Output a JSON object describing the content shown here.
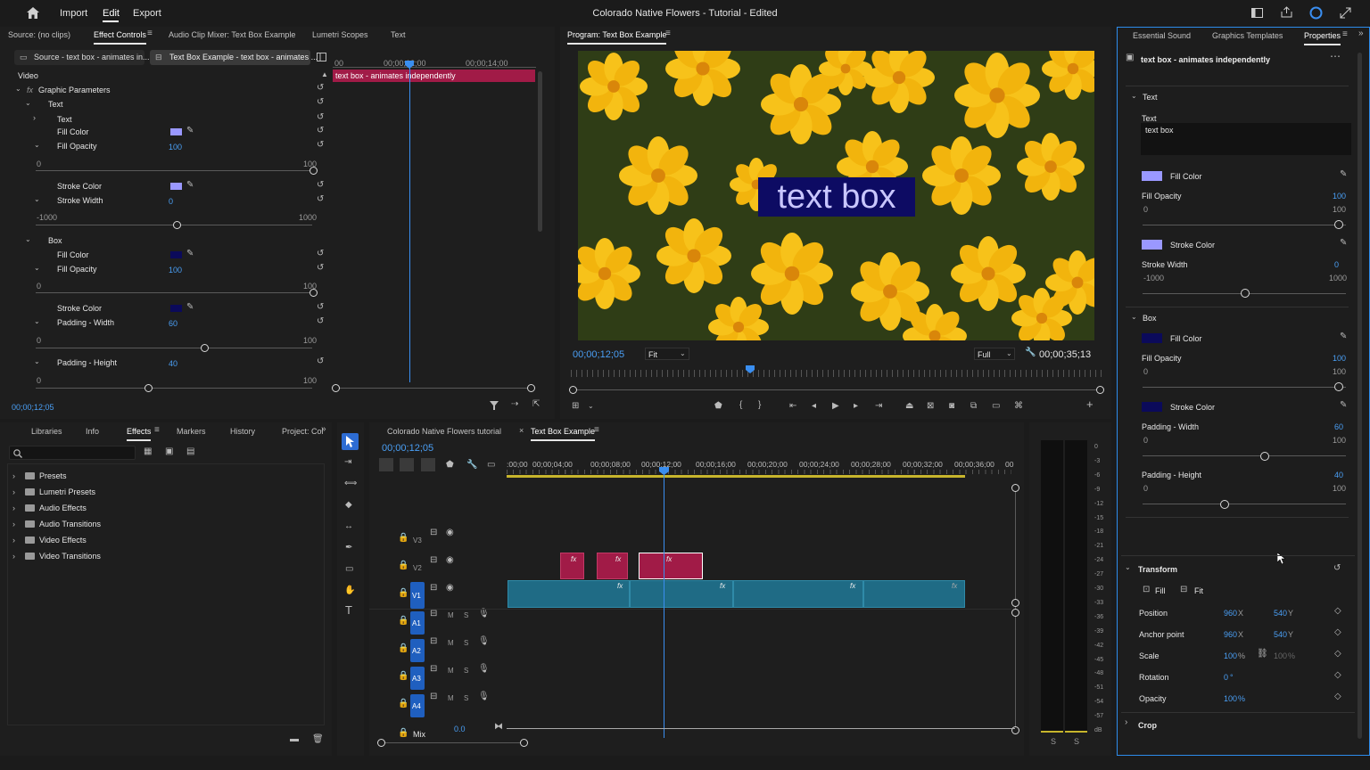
{
  "menubar": {
    "items": [
      "Import",
      "Edit",
      "Export"
    ],
    "title": "Colorado Native Flowers - Tutorial - Edited"
  },
  "effect_controls": {
    "tabs": [
      "Source: (no clips)",
      "Effect Controls",
      "Audio Clip Mixer: Text Box Example",
      "Lumetri Scopes",
      "Text"
    ],
    "sub_tabs": [
      "Source - text box - animates in...",
      "Text Box Example - text box - animates ..."
    ],
    "ruler": [
      "00",
      "00;00;12;00",
      "00;00;14;00"
    ],
    "clip_label": "text box - animates independently",
    "video_label": "Video",
    "graphic_params": "Graphic Parameters",
    "text_group": "Text",
    "text_item": "Text",
    "fill_color": "Fill Color",
    "fill_opacity": "Fill Opacity",
    "fill_opacity_val": "100",
    "range_0": "0",
    "range_100": "100",
    "stroke_color": "Stroke Color",
    "stroke_width": "Stroke Width",
    "stroke_width_val": "0",
    "range_n1000": "-1000",
    "range_1000": "1000",
    "box_group": "Box",
    "box_fill_color": "Fill Color",
    "box_fill_opacity": "Fill Opacity",
    "box_fill_opacity_val": "100",
    "box_stroke_color": "Stroke Color",
    "padding_width": "Padding - Width",
    "padding_width_val": "60",
    "padding_height": "Padding - Height",
    "padding_height_val": "40",
    "timecode": "00;00;12;05"
  },
  "program": {
    "title": "Program: Text Box Example",
    "overlay_text": "text box",
    "timecode": "00;00;12;05",
    "fit": "Fit",
    "quality": "Full",
    "duration": "00;00;35;13"
  },
  "right_panel": {
    "tabs": [
      "Essential Sound",
      "Graphics Templates",
      "Properties"
    ],
    "layer_name": "text box - animates independently",
    "text_section": "Text",
    "text_label": "Text",
    "text_value": "text box",
    "fill_color": "Fill Color",
    "fill_opacity": "Fill Opacity",
    "fill_opacity_val": "100",
    "r0": "0",
    "r100": "100",
    "stroke_color": "Stroke Color",
    "stroke_width": "Stroke Width",
    "stroke_width_val": "0",
    "rn1000": "-1000",
    "r1000": "1000",
    "box_section": "Box",
    "box_fill_color": "Fill Color",
    "box_fill_opacity": "Fill Opacity",
    "box_fill_opacity_val": "100",
    "box_stroke_color": "Stroke Color",
    "padding_width": "Padding - Width",
    "padding_width_val": "60",
    "padding_height": "Padding - Height",
    "padding_height_val": "40",
    "transform": "Transform",
    "fill": "Fill",
    "fit": "Fit",
    "position": "Position",
    "position_x": "960",
    "position_y": "540",
    "anchor": "Anchor point",
    "anchor_x": "960",
    "anchor_y": "540",
    "x_label": "X",
    "y_label": "Y",
    "scale": "Scale",
    "scale_val": "100",
    "scale_val2": "100",
    "pct": "%",
    "rotation": "Rotation",
    "rotation_val": "0",
    "deg": "°",
    "opacity": "Opacity",
    "opacity_val": "100",
    "crop": "Crop"
  },
  "effects_panel": {
    "tabs": [
      "Libraries",
      "Info",
      "Effects",
      "Markers",
      "History",
      "Project: Col"
    ],
    "folders": [
      "Presets",
      "Lumetri Presets",
      "Audio Effects",
      "Audio Transitions",
      "Video Effects",
      "Video Transitions"
    ]
  },
  "timeline": {
    "tabs": [
      "Colorado Native Flowers tutorial",
      "Text Box Example"
    ],
    "timecode": "00;00;12;05",
    "ruler": [
      ":00;00",
      "00;00;04;00",
      "00;00;08;00",
      "00;00;12;00",
      "00;00;16;00",
      "00;00;20;00",
      "00;00;24;00",
      "00;00;28;00",
      "00;00;32;00",
      "00;00;36;00",
      "00"
    ],
    "tracks": [
      "V3",
      "V2",
      "V1",
      "A1",
      "A2",
      "A3",
      "A4"
    ],
    "mix": "Mix",
    "mix_val": "0.0",
    "fx": "fx",
    "m": "M",
    "s": "S"
  },
  "meter": {
    "scale": [
      "0",
      "-3",
      "-6",
      "-9",
      "-12",
      "-15",
      "-18",
      "-21",
      "-24",
      "-27",
      "-30",
      "-33",
      "-36",
      "-39",
      "-42",
      "-45",
      "-48",
      "-51",
      "-54",
      "-57",
      "dB"
    ],
    "s_labels": [
      "S",
      "S"
    ]
  },
  "colors": {
    "accent": "#2d8ceb",
    "clip_pink": "#b01e4b",
    "clip_teal": "#1f6b85",
    "fill_color": "#9a98ff",
    "box_fill": "#0b0a5a"
  }
}
